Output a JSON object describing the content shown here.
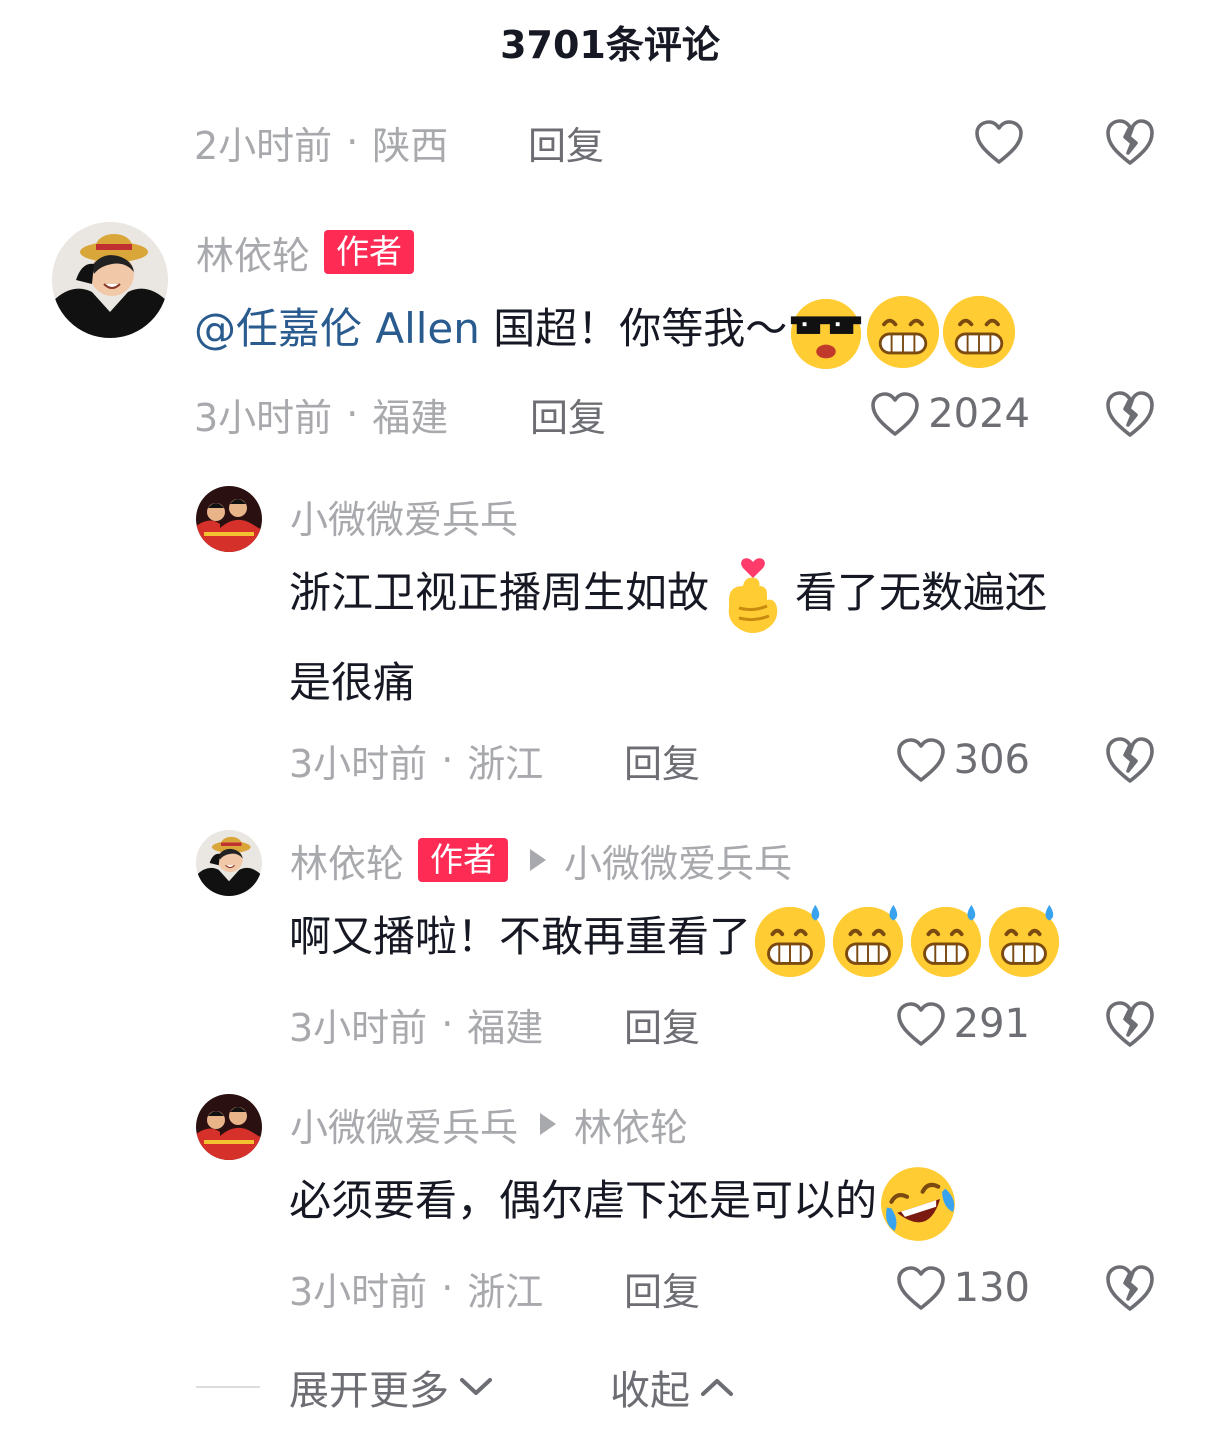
{
  "header": {
    "title": "3701条评论"
  },
  "colors": {
    "accent": "#fe2c55",
    "mention": "#2a5b8f",
    "meta": "#a8a9ad"
  },
  "top_meta": {
    "time": "2小时前",
    "sep": "·",
    "location": "陕西",
    "reply": "回复"
  },
  "comment_author": {
    "name": "林依轮",
    "badge": "作者",
    "mention": "@任嘉伦 Allen",
    "text": " 国超！你等我～",
    "emojis": [
      "sunglasses-emoji",
      "grin-emoji",
      "grin-emoji"
    ],
    "time": "3小时前",
    "sep": "·",
    "location": "福建",
    "reply": "回复",
    "likes": "2024"
  },
  "reply_1": {
    "name": "小微微爱兵乓",
    "text_a": "浙江卫视正播周生如故",
    "text_b": "看了无数遍还",
    "text_c": "是很痛",
    "emojis": [
      "finger-heart-emoji"
    ],
    "time": "3小时前",
    "sep": "·",
    "location": "浙江",
    "reply": "回复",
    "likes": "306"
  },
  "reply_2": {
    "name": "林依轮",
    "badge": "作者",
    "reply_to": "小微微爱兵乓",
    "text": "啊又播啦！不敢再重看了",
    "emojis": [
      "sweat-grin-emoji",
      "sweat-grin-emoji",
      "sweat-grin-emoji",
      "sweat-grin-emoji"
    ],
    "time": "3小时前",
    "sep": "·",
    "location": "福建",
    "reply": "回复",
    "likes": "291"
  },
  "reply_3": {
    "name": "小微微爱兵乓",
    "reply_to": "林依轮",
    "text": "必须要看，偶尔虐下还是可以的",
    "emojis": [
      "crying-laughing-emoji"
    ],
    "time": "3小时前",
    "sep": "·",
    "location": "浙江",
    "reply": "回复",
    "likes": "130"
  },
  "footer": {
    "expand": "展开更多",
    "collapse": "收起"
  }
}
